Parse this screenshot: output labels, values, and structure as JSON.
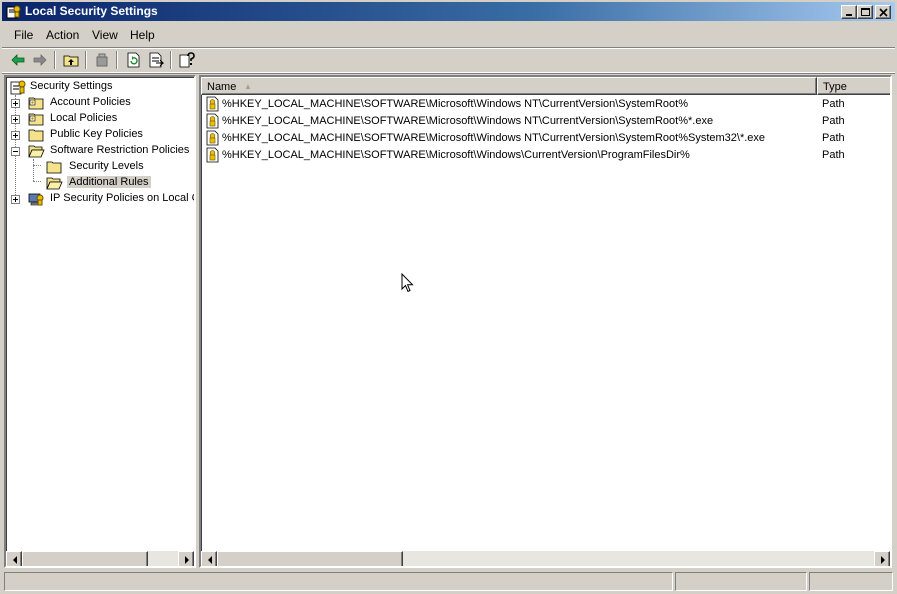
{
  "window": {
    "title": "Local Security Settings"
  },
  "menu": [
    "File",
    "Action",
    "View",
    "Help"
  ],
  "tree": {
    "root": "Security Settings",
    "items": [
      {
        "label": "Account Policies"
      },
      {
        "label": "Local Policies"
      },
      {
        "label": "Public Key Policies"
      },
      {
        "label": "Software Restriction Policies"
      },
      {
        "label": "Security Levels"
      },
      {
        "label": "Additional Rules"
      },
      {
        "label": "IP Security Policies on Local Co"
      }
    ]
  },
  "list": {
    "columns": [
      "Name",
      "Type"
    ],
    "sort_indicator": "▲",
    "rows": [
      {
        "name": "%HKEY_LOCAL_MACHINE\\SOFTWARE\\Microsoft\\Windows NT\\CurrentVersion\\SystemRoot%",
        "type": "Path"
      },
      {
        "name": "%HKEY_LOCAL_MACHINE\\SOFTWARE\\Microsoft\\Windows NT\\CurrentVersion\\SystemRoot%*.exe",
        "type": "Path"
      },
      {
        "name": "%HKEY_LOCAL_MACHINE\\SOFTWARE\\Microsoft\\Windows NT\\CurrentVersion\\SystemRoot%System32\\*.exe",
        "type": "Path"
      },
      {
        "name": "%HKEY_LOCAL_MACHINE\\SOFTWARE\\Microsoft\\Windows\\CurrentVersion\\ProgramFilesDir%",
        "type": "Path"
      }
    ]
  },
  "icons": {
    "title": "security-settings-icon",
    "toolbar": [
      "back-arrow-icon",
      "forward-arrow-icon",
      "up-folder-icon",
      "delete-icon",
      "refresh-icon",
      "export-list-icon",
      "help-icon"
    ]
  },
  "colors": {
    "titlebar_start": "#0a246a",
    "titlebar_end": "#a6caf0",
    "face": "#d4d0c8"
  }
}
